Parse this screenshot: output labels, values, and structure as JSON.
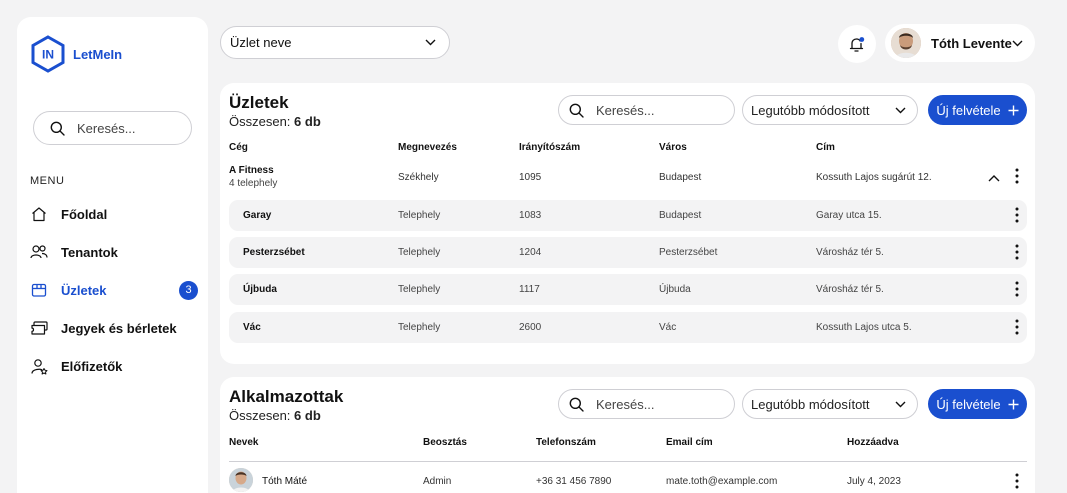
{
  "brand": {
    "name": "LetMeIn",
    "logo_text": "IN"
  },
  "sidebar": {
    "search_placeholder": "Keresés...",
    "menu_label": "MENU",
    "items": [
      {
        "label": "Főoldal",
        "icon": "home-icon"
      },
      {
        "label": "Tenantok",
        "icon": "users-icon"
      },
      {
        "label": "Üzletek",
        "icon": "store-icon",
        "badge": "3",
        "active": true
      },
      {
        "label": "Jegyek és bérletek",
        "icon": "ticket-icon"
      },
      {
        "label": "Előfizetők",
        "icon": "subscriber-icon"
      }
    ]
  },
  "topbar": {
    "store_select": "Üzlet neve",
    "user_name": "Tóth Levente"
  },
  "stores_card": {
    "title": "Üzletek",
    "subtitle_prefix": "Összesen:",
    "subtitle_count": "6 db",
    "search_placeholder": "Keresés...",
    "sort_value": "Legutóbb módosított",
    "new_button": "Új felvétele",
    "columns": [
      "Cég",
      "Megnevezés",
      "Irányítószám",
      "Város",
      "Cím"
    ],
    "parent": {
      "name": "A Fitness",
      "sub": "4 telephely",
      "type": "Székhely",
      "zip": "1095",
      "city": "Budapest",
      "address": "Kossuth Lajos sugárút 12."
    },
    "children": [
      {
        "name": "Garay",
        "type": "Telephely",
        "zip": "1083",
        "city": "Budapest",
        "address": "Garay utca 15."
      },
      {
        "name": "Pesterzsébet",
        "type": "Telephely",
        "zip": "1204",
        "city": "Pesterzsébet",
        "address": "Városház tér 5."
      },
      {
        "name": "Újbuda",
        "type": "Telephely",
        "zip": "1117",
        "city": "Újbuda",
        "address": "Városház tér 5."
      },
      {
        "name": "Vác",
        "type": "Telephely",
        "zip": "2600",
        "city": "Vác",
        "address": "Kossuth Lajos utca 5."
      }
    ]
  },
  "employees_card": {
    "title": "Alkalmazottak",
    "subtitle_prefix": "Összesen:",
    "subtitle_count": "6 db",
    "search_placeholder": "Keresés...",
    "sort_value": "Legutóbb módosított",
    "new_button": "Új felvétele",
    "columns": [
      "Nevek",
      "Beosztás",
      "Telefonszám",
      "Email cím",
      "Hozzáadva"
    ],
    "rows": [
      {
        "name": "Tóth Máté",
        "role": "Admin",
        "phone": "+36 31 456 7890",
        "email": "mate.toth@example.com",
        "added": "July 4, 2023"
      }
    ]
  },
  "colors": {
    "accent": "#1a4fcf",
    "background": "#f3f3f4",
    "row_bg": "#f3f3f4"
  }
}
